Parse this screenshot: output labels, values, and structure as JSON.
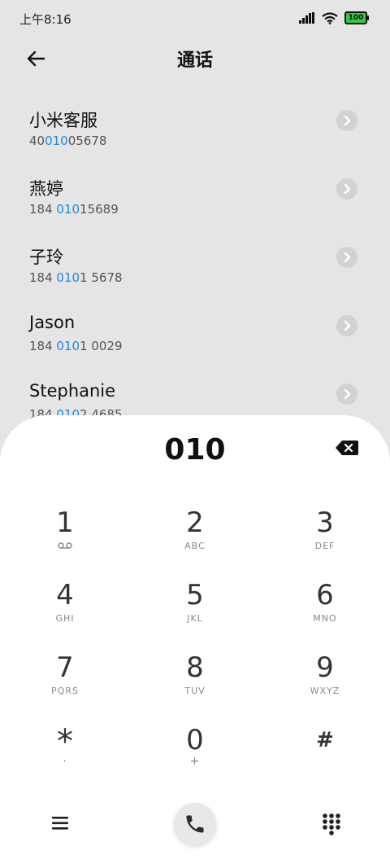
{
  "status": {
    "time": "上午8:16",
    "battery": "100"
  },
  "header": {
    "title": "通话"
  },
  "contacts": [
    {
      "name": "小米客服",
      "number_pre": "40",
      "number_hl": "010",
      "number_post": "05678"
    },
    {
      "name": "燕婷",
      "number_pre": "184 ",
      "number_hl": "010",
      "number_post": "15689"
    },
    {
      "name": "子玲",
      "number_pre": "184 ",
      "number_hl": "010",
      "number_post": "1 5678"
    },
    {
      "name": "Jason",
      "number_pre": "184 ",
      "number_hl": "010",
      "number_post": "1 0029"
    },
    {
      "name": "Stephanie",
      "number_pre": "184 ",
      "number_hl": "010",
      "number_post": "2 4685"
    }
  ],
  "dialer": {
    "input": "010",
    "keys": [
      {
        "digit": "1",
        "letters": ""
      },
      {
        "digit": "2",
        "letters": "ABC"
      },
      {
        "digit": "3",
        "letters": "DEF"
      },
      {
        "digit": "4",
        "letters": "GHI"
      },
      {
        "digit": "5",
        "letters": "JKL"
      },
      {
        "digit": "6",
        "letters": "MNO"
      },
      {
        "digit": "7",
        "letters": "PQRS"
      },
      {
        "digit": "8",
        "letters": "TUV"
      },
      {
        "digit": "9",
        "letters": "WXYZ"
      },
      {
        "digit": "*",
        "letters": ","
      },
      {
        "digit": "0",
        "letters": "+"
      },
      {
        "digit": "#",
        "letters": ""
      }
    ]
  },
  "colors": {
    "highlight": "#1e88e5",
    "background": "#e5e5e5",
    "battery": "#2ecc40"
  }
}
